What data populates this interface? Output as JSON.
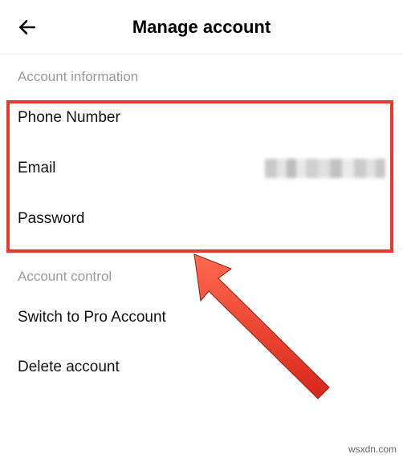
{
  "header": {
    "title": "Manage account"
  },
  "sections": {
    "info": {
      "label": "Account information",
      "phone": "Phone Number",
      "email": "Email",
      "password": "Password"
    },
    "control": {
      "label": "Account control",
      "switch_pro": "Switch to Pro Account",
      "delete": "Delete account"
    }
  },
  "annotation": {
    "highlight_color": "#e63a2e"
  },
  "watermark": "wsxdn.com"
}
